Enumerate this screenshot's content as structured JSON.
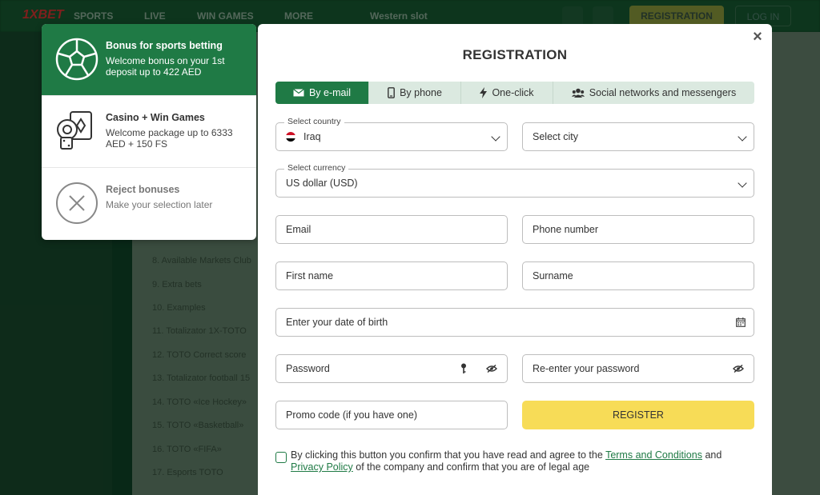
{
  "background": {
    "logo": "1XBET",
    "nav": [
      "SPORTS",
      "LIVE",
      "WIN GAMES",
      "MORE"
    ],
    "nav_extra": "Western slot",
    "registration_label": "REGISTRATION",
    "login_label": "LOG IN",
    "list_items": [
      "8. Available Markets Club",
      "9. Extra bets",
      "10. Examples",
      "11. Totalizator 1X-TOTO",
      "12. TOTO Correct score",
      "13. Totalizator football 15",
      "14. TOTO «Ice Hockey»",
      "15. TOTO «Basketball»",
      "16. TOTO «FIFA»",
      "17. Esports TOTO"
    ]
  },
  "bonus_panel": {
    "items": [
      {
        "title": "Bonus for sports betting",
        "desc": "Welcome bonus on your 1st deposit up to 422 AED",
        "icon": "soccer-ball-icon"
      },
      {
        "title": "Casino + Win Games",
        "desc": "Welcome package up to 6333 AED + 150 FS",
        "icon": "casino-cards-icon"
      },
      {
        "title": "Reject bonuses",
        "desc": "Make your selection later",
        "icon": "reject-x-icon"
      }
    ]
  },
  "modal": {
    "title": "REGISTRATION",
    "close": "×",
    "tabs": [
      {
        "label": "By e-mail",
        "icon": "envelope-icon"
      },
      {
        "label": "By phone",
        "icon": "phone-icon"
      },
      {
        "label": "One-click",
        "icon": "lightning-icon"
      },
      {
        "label": "Social networks and messengers",
        "icon": "users-icon"
      }
    ],
    "country_label": "Select country",
    "country_value": "Iraq",
    "city_placeholder": "Select city",
    "currency_label": "Select currency",
    "currency_value": "US dollar (USD)",
    "email_placeholder": "Email",
    "phone_placeholder": "Phone number",
    "first_name_placeholder": "First name",
    "surname_placeholder": "Surname",
    "dob_placeholder": "Enter your date of birth",
    "password_placeholder": "Password",
    "repassword_placeholder": "Re-enter your password",
    "promo_placeholder": "Promo code (if you have one)",
    "register_label": "REGISTER",
    "consent_part1": "By clicking this button you confirm that you have read and agree to the ",
    "terms_link": "Terms and Conditions",
    "consent_and": " and ",
    "privacy_link": "Privacy Policy",
    "consent_part2": " of the company and confirm that you are of legal age"
  },
  "colors": {
    "accent": "#1f7a45",
    "register": "#f7dc57",
    "tab_bg": "#dbe9e0"
  }
}
